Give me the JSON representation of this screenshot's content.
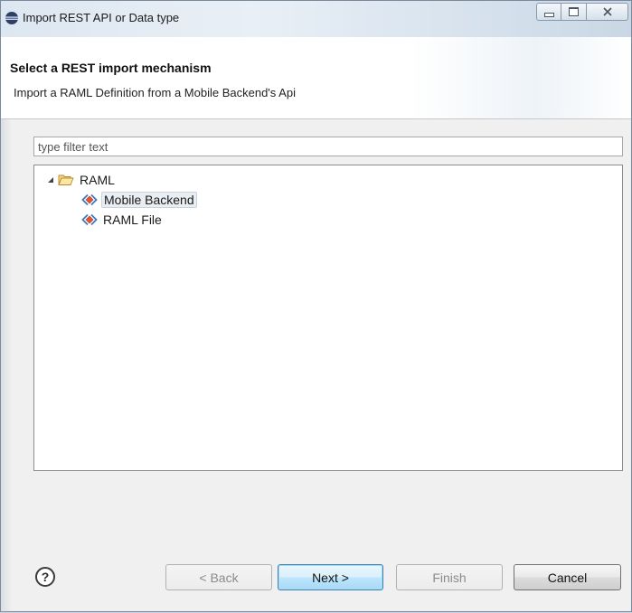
{
  "window": {
    "title": "Import REST API or Data type",
    "caption_buttons": [
      "minimize",
      "maximize",
      "close"
    ]
  },
  "header": {
    "title": "Select a REST import mechanism",
    "description": "Import a RAML Definition from a Mobile Backend's Api"
  },
  "filter": {
    "placeholder": "type filter text",
    "value": ""
  },
  "tree": {
    "root": {
      "label": "RAML",
      "expanded": true,
      "icon": "folder-open-icon"
    },
    "children": [
      {
        "label": "Mobile Backend",
        "icon": "raml-resource-icon",
        "selected": true
      },
      {
        "label": "RAML File",
        "icon": "raml-resource-icon",
        "selected": false
      }
    ]
  },
  "buttons": {
    "help": "?",
    "back": "< Back",
    "next": "Next >",
    "finish": "Finish",
    "cancel": "Cancel"
  },
  "colors": {
    "default_button_border": "#3c7fb1",
    "selection_bg": "#e9eef3",
    "tree_icon_blue": "#3a78c2",
    "folder_yellow": "#e8b64a"
  }
}
